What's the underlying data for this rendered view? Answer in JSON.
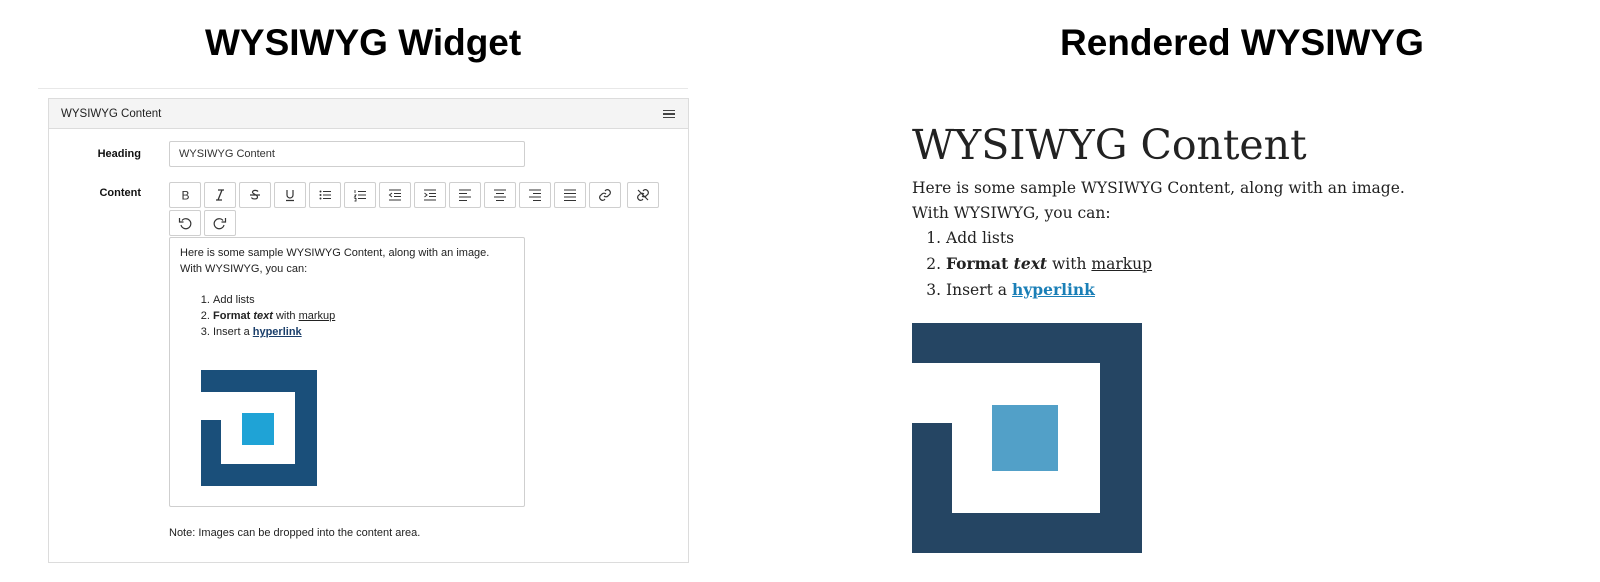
{
  "titles": {
    "widget": "WYSIWYG Widget",
    "rendered": "Rendered WYSIWYG"
  },
  "widget": {
    "panel_title": "WYSIWYG Content",
    "heading_label": "Heading",
    "heading_value": "WYSIWYG Content",
    "content_label": "Content",
    "toolbar": [
      "bold",
      "italic",
      "strikethrough",
      "underline",
      "bullet-list",
      "numbered-list",
      "outdent",
      "indent",
      "align-left",
      "align-center",
      "align-right",
      "justify",
      "link",
      "unlink",
      "undo",
      "redo"
    ],
    "editor": {
      "line1": "Here is some sample WYSIWYG Content, along with an image.",
      "line2": "With WYSIWYG, you can:",
      "item1": "Add lists",
      "item2_bold": "Format",
      "item2_italic": "text",
      "item2_mid": "with",
      "item2_underline": "markup",
      "item3_pre": "Insert a",
      "item3_link": "hyperlink"
    },
    "note": "Note: Images can be dropped into the content area."
  },
  "rendered": {
    "heading": "WYSIWYG Content",
    "line1": "Here is some sample WYSIWYG Content, along with an image.",
    "line2": "With WYSIWYG, you can:",
    "item1": "Add lists",
    "item2_bold": "Format",
    "item2_italic": "text",
    "item2_mid": "with",
    "item2_underline": "markup",
    "item3_pre": "Insert a",
    "item3_link": "hyperlink"
  },
  "colors": {
    "logo_dark": "#1a4f7a",
    "logo_light": "#1fa3d6",
    "rendered_logo_dark": "#254563",
    "rendered_logo_light": "#52a0c8",
    "link": "#1a7fb7"
  }
}
